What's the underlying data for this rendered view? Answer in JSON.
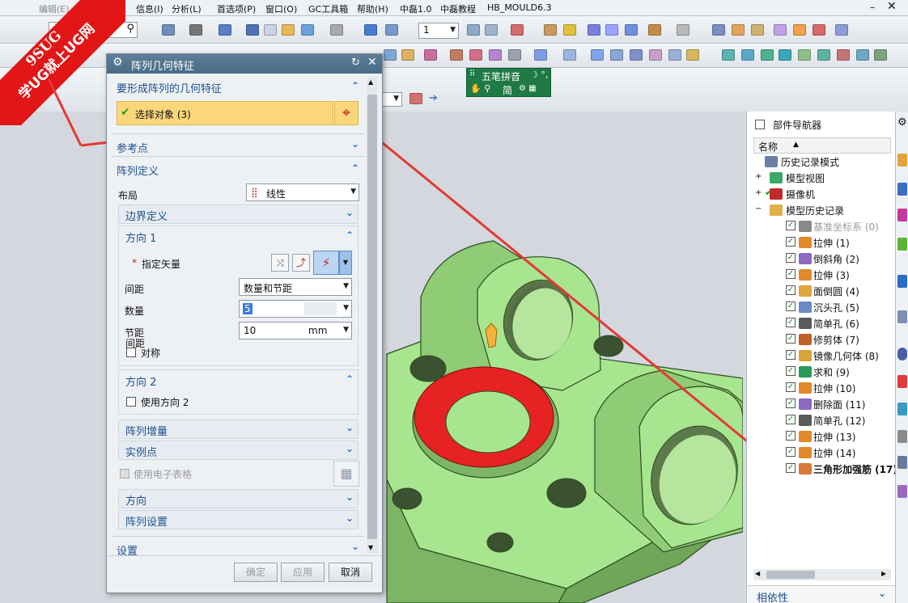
{
  "menubar": {
    "items": [
      "信息(I)",
      "分析(L)",
      "首选项(P)",
      "窗口(O)",
      "GC工具箱",
      "帮助(H)",
      "中磊1.0",
      "中磊教程",
      "HB_MOULD6.3"
    ],
    "truncated_left": "编辑(E)"
  },
  "toolbar": {
    "number_field": "1",
    "ime": {
      "label": "五笔拼音",
      "sub": "简"
    }
  },
  "watermark": {
    "line1": "9SUG",
    "line2": "学UG就上UG网"
  },
  "dialog": {
    "title": "阵列几何特征",
    "section_geometry": "要形成阵列的几何特征",
    "select_object": "选择对象 (3)",
    "section_reference": "参考点",
    "section_pattern": "阵列定义",
    "layout_label": "布局",
    "layout_value": "线性",
    "boundary": "边界定义",
    "direction1": "方向 1",
    "specify_vector": "指定矢量",
    "spacing_label": "间距",
    "spacing_value": "数量和节距",
    "count_label": "数量",
    "count_value": "5",
    "pitch_label": "节距",
    "pitch_value": "10",
    "pitch_unit": "mm",
    "symmetric": "对称",
    "direction2": "方向 2",
    "use_direction2": "使用方向 2",
    "increment": "阵列增量",
    "instance": "实例点",
    "spreadsheet": "使用电子表格",
    "orientation": "方向",
    "pattern_settings": "阵列设置",
    "settings": "设置",
    "ok": "确定",
    "apply": "应用",
    "cancel": "取消"
  },
  "navigator": {
    "title": "部件导航器",
    "column_name": "名称",
    "nodes": [
      {
        "label": "历史记录模式"
      },
      {
        "label": "模型视图"
      },
      {
        "label": "摄像机"
      },
      {
        "label": "模型历史记录"
      }
    ],
    "features": [
      {
        "label": "基准坐标系 (0)",
        "dim": true
      },
      {
        "label": "拉伸 (1)"
      },
      {
        "label": "倒斜角 (2)"
      },
      {
        "label": "拉伸 (3)"
      },
      {
        "label": "面倒圆 (4)"
      },
      {
        "label": "沉头孔 (5)"
      },
      {
        "label": "简单孔 (6)"
      },
      {
        "label": "修剪体 (7)"
      },
      {
        "label": "镜像几何体 (8)"
      },
      {
        "label": "求和 (9)"
      },
      {
        "label": "拉伸 (10)"
      },
      {
        "label": "删除面 (11)"
      },
      {
        "label": "简单孔 (12)"
      },
      {
        "label": "拉伸 (13)"
      },
      {
        "label": "拉伸 (14)"
      },
      {
        "label": "三角形加强筋 (17)",
        "bold": true
      }
    ],
    "dependency": "相依性"
  },
  "colors": {
    "model_green": "#a8e58f",
    "model_face_dark": "#84c26c",
    "highlight_red": "#e62222",
    "viewport_bg": "#d4d8de",
    "dialog_title": "#4f7390",
    "select_row": "#fbd77a",
    "arrow_red": "#e53935"
  }
}
